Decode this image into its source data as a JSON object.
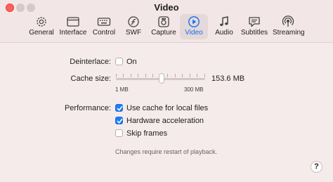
{
  "window": {
    "title": "Video"
  },
  "toolbar": {
    "tabs": [
      {
        "label": "General",
        "icon": "gear-icon"
      },
      {
        "label": "Interface",
        "icon": "window-icon"
      },
      {
        "label": "Control",
        "icon": "keyboard-icon"
      },
      {
        "label": "SWF",
        "icon": "flash-icon"
      },
      {
        "label": "Capture",
        "icon": "camera-icon"
      },
      {
        "label": "Video",
        "icon": "play-icon",
        "selected": true
      },
      {
        "label": "Audio",
        "icon": "music-note-icon"
      },
      {
        "label": "Subtitles",
        "icon": "speech-bubble-icon"
      },
      {
        "label": "Streaming",
        "icon": "broadcast-icon"
      }
    ]
  },
  "settings": {
    "deinterlace": {
      "label": "Deinterlace:",
      "option": "On",
      "checked": false
    },
    "cache": {
      "label": "Cache size:",
      "value": "153.6 MB",
      "min_label": "1 MB",
      "max_label": "300 MB",
      "level_fraction": 0.51
    },
    "performance": {
      "label": "Performance:",
      "options": [
        {
          "label": "Use cache for local files",
          "checked": true
        },
        {
          "label": "Hardware acceleration",
          "checked": true
        },
        {
          "label": "Skip frames",
          "checked": false
        }
      ]
    },
    "note": "Changes require restart of playback."
  },
  "help": {
    "label": "?"
  },
  "colors": {
    "accent": "#1f7cf5",
    "selected_tab_text": "#1a6df1",
    "close_button": "#ff5f57"
  }
}
